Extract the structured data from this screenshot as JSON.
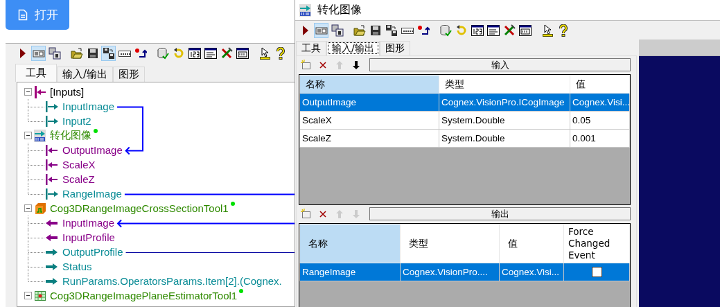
{
  "open_button": {
    "label": "打开"
  },
  "tool_window": {
    "toolbar": [
      {
        "kind": "run",
        "pressed": false
      },
      {
        "kind": "show",
        "pressed": true
      },
      {
        "kind": "windows",
        "pressed": false
      },
      {
        "kind": "open",
        "pressed": false
      },
      {
        "kind": "save",
        "pressed": false
      },
      {
        "kind": "savesettings",
        "pressed": true
      },
      {
        "kind": "dots",
        "pressed": false
      },
      {
        "kind": "reddot",
        "pressed": false
      },
      {
        "kind": "db",
        "pressed": false
      },
      {
        "kind": "reset",
        "pressed": false
      },
      {
        "kind": "num",
        "pressed": false
      },
      {
        "kind": "text",
        "pressed": false
      },
      {
        "kind": "tools",
        "pressed": false
      },
      {
        "kind": "dbg",
        "pressed": false
      },
      {
        "kind": "pointer",
        "pressed": false
      },
      {
        "kind": "help",
        "pressed": false
      }
    ],
    "tabs": [
      {
        "label": "工具",
        "selected": true
      },
      {
        "label": "输入/输出",
        "selected": false
      },
      {
        "label": "图形",
        "selected": false
      }
    ],
    "tree": [
      {
        "label": "[Inputs]",
        "kind": "inputs",
        "expanded": true,
        "dot": false,
        "children": [
          {
            "label": "InputImage",
            "kind": "out-bar"
          },
          {
            "label": "Input2",
            "kind": "out-bar"
          }
        ]
      },
      {
        "label": "转化图像",
        "kind": "script",
        "expanded": true,
        "dot": true,
        "children": [
          {
            "label": "OutputImage",
            "kind": "in-bar"
          },
          {
            "label": "ScaleX",
            "kind": "in-bar"
          },
          {
            "label": "ScaleZ",
            "kind": "in-bar"
          },
          {
            "label": "RangeImage",
            "kind": "out-bar"
          }
        ]
      },
      {
        "label": "Cog3DRangeImageCrossSectionTool1",
        "kind": "cross-section",
        "expanded": true,
        "dot": true,
        "children": [
          {
            "label": "InputImage",
            "kind": "in"
          },
          {
            "label": "InputProfile",
            "kind": "in"
          },
          {
            "label": "OutputProfile",
            "kind": "out"
          },
          {
            "label": "Status",
            "kind": "out"
          },
          {
            "label": "RunParams.OperatorsParams.Item[2].(Cognex.",
            "kind": "out"
          }
        ]
      },
      {
        "label": "Cog3DRangeImagePlaneEstimatorTool1",
        "kind": "plane",
        "expanded": true,
        "dot": true
      }
    ]
  },
  "dialog": {
    "title": "转化图像",
    "toolbar": [
      {
        "kind": "run",
        "pressed": false
      },
      {
        "kind": "show",
        "pressed": true
      },
      {
        "kind": "windows",
        "pressed": false
      },
      {
        "kind": "open",
        "pressed": false
      },
      {
        "kind": "save",
        "pressed": false
      },
      {
        "kind": "savesettings",
        "pressed": false
      },
      {
        "kind": "dots",
        "pressed": false
      },
      {
        "kind": "reddot",
        "pressed": false
      },
      {
        "kind": "db",
        "pressed": false
      },
      {
        "kind": "reset",
        "pressed": false
      },
      {
        "kind": "num",
        "pressed": false
      },
      {
        "kind": "text",
        "pressed": false
      },
      {
        "kind": "tools",
        "pressed": false
      },
      {
        "kind": "dbg",
        "pressed": false
      },
      {
        "kind": "pointer",
        "pressed": false
      },
      {
        "kind": "help",
        "pressed": false
      }
    ],
    "tabs": [
      {
        "label": "工具",
        "selected": false
      },
      {
        "label": "输入/输出",
        "selected": true
      },
      {
        "label": "图形",
        "selected": false
      }
    ],
    "inputs": {
      "header": "输入",
      "tools": [
        {
          "kind": "new",
          "disabled": false
        },
        {
          "kind": "delete",
          "disabled": false
        },
        {
          "kind": "up",
          "disabled": true
        },
        {
          "kind": "down",
          "disabled": false
        }
      ],
      "columns": [
        {
          "label": "名称",
          "highlighted": true
        },
        {
          "label": "类型",
          "highlighted": false
        },
        {
          "label": "值",
          "highlighted": false
        }
      ],
      "rows": [
        {
          "cells": [
            "OutputImage",
            "Cognex.VisionPro.ICogImage",
            "Cognex.Visi..."
          ],
          "selected": true
        },
        {
          "cells": [
            "ScaleX",
            "System.Double",
            "0.05"
          ],
          "selected": false
        },
        {
          "cells": [
            "ScaleZ",
            "System.Double",
            "0.001"
          ],
          "selected": false
        }
      ]
    },
    "outputs": {
      "header": "输出",
      "tools": [
        {
          "kind": "new",
          "disabled": false
        },
        {
          "kind": "delete",
          "disabled": false
        },
        {
          "kind": "up",
          "disabled": true
        },
        {
          "kind": "down",
          "disabled": true
        }
      ],
      "columns": [
        {
          "label": "名称",
          "highlighted": true
        },
        {
          "label": "类型",
          "highlighted": false
        },
        {
          "label": "值",
          "highlighted": false
        },
        {
          "label": "Force Changed Event",
          "highlighted": false
        }
      ],
      "rows": [
        {
          "cells": [
            "RangeImage",
            "Cognex.VisionPro....",
            "Cognex.Visi..."
          ],
          "checked": false,
          "selected": true
        }
      ]
    }
  }
}
